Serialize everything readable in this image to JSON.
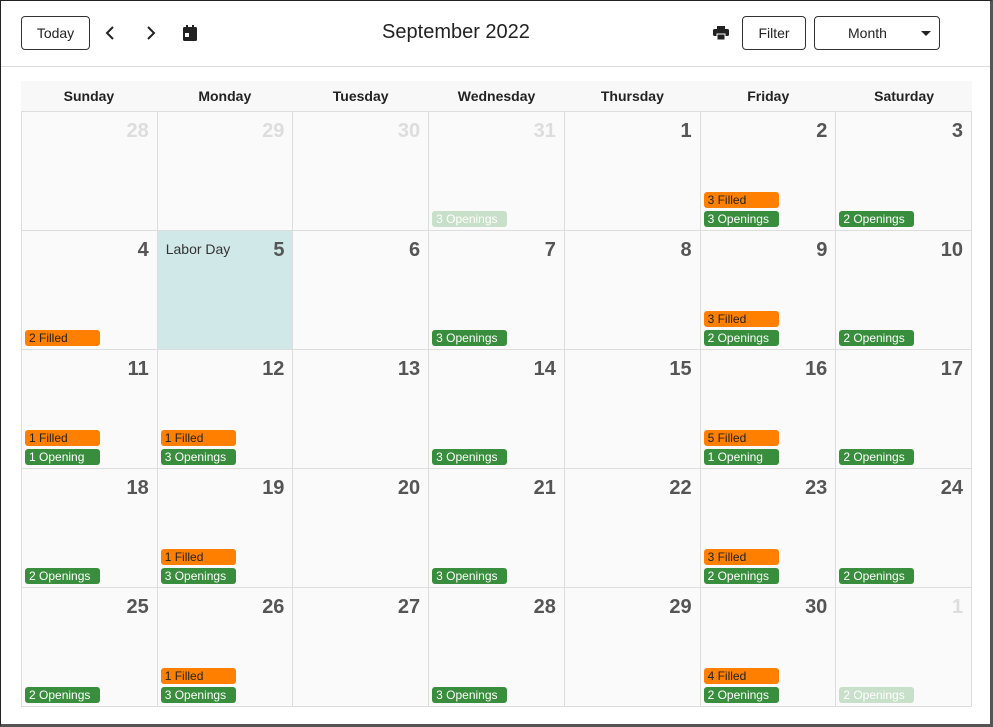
{
  "toolbar": {
    "today_label": "Today",
    "title": "September 2022",
    "filter_label": "Filter",
    "view_label": "Month"
  },
  "colors": {
    "filled": "#ff7f00",
    "openings": "#388e3c",
    "holiday": "#d1e8e9"
  },
  "weekdays": [
    "Sunday",
    "Monday",
    "Tuesday",
    "Wednesday",
    "Thursday",
    "Friday",
    "Saturday"
  ],
  "weeks": [
    [
      {
        "day": "28",
        "muted": true,
        "events": []
      },
      {
        "day": "29",
        "muted": true,
        "events": []
      },
      {
        "day": "30",
        "muted": true,
        "events": []
      },
      {
        "day": "31",
        "muted": true,
        "events": [
          {
            "type": "open",
            "label": "3 Openings"
          }
        ]
      },
      {
        "day": "1",
        "events": []
      },
      {
        "day": "2",
        "events": [
          {
            "type": "filled",
            "label": "3 Filled"
          },
          {
            "type": "open",
            "label": "3 Openings"
          }
        ]
      },
      {
        "day": "3",
        "events": [
          {
            "type": "open",
            "label": "2 Openings"
          }
        ]
      }
    ],
    [
      {
        "day": "4",
        "events": [
          {
            "type": "filled",
            "label": "2 Filled"
          }
        ]
      },
      {
        "day": "5",
        "holiday": "Labor Day",
        "events": []
      },
      {
        "day": "6",
        "events": []
      },
      {
        "day": "7",
        "events": [
          {
            "type": "open",
            "label": "3 Openings"
          }
        ]
      },
      {
        "day": "8",
        "events": []
      },
      {
        "day": "9",
        "events": [
          {
            "type": "filled",
            "label": "3 Filled"
          },
          {
            "type": "open",
            "label": "2 Openings"
          }
        ]
      },
      {
        "day": "10",
        "events": [
          {
            "type": "open",
            "label": "2 Openings"
          }
        ]
      }
    ],
    [
      {
        "day": "11",
        "events": [
          {
            "type": "filled",
            "label": "1 Filled"
          },
          {
            "type": "open",
            "label": "1 Opening"
          }
        ]
      },
      {
        "day": "12",
        "events": [
          {
            "type": "filled",
            "label": "1 Filled"
          },
          {
            "type": "open",
            "label": "3 Openings"
          }
        ]
      },
      {
        "day": "13",
        "events": []
      },
      {
        "day": "14",
        "events": [
          {
            "type": "open",
            "label": "3 Openings"
          }
        ]
      },
      {
        "day": "15",
        "events": []
      },
      {
        "day": "16",
        "events": [
          {
            "type": "filled",
            "label": "5 Filled"
          },
          {
            "type": "open",
            "label": "1 Opening"
          }
        ]
      },
      {
        "day": "17",
        "events": [
          {
            "type": "open",
            "label": "2 Openings"
          }
        ]
      }
    ],
    [
      {
        "day": "18",
        "events": [
          {
            "type": "open",
            "label": "2 Openings"
          }
        ]
      },
      {
        "day": "19",
        "events": [
          {
            "type": "filled",
            "label": "1 Filled"
          },
          {
            "type": "open",
            "label": "3 Openings"
          }
        ]
      },
      {
        "day": "20",
        "events": []
      },
      {
        "day": "21",
        "events": [
          {
            "type": "open",
            "label": "3 Openings"
          }
        ]
      },
      {
        "day": "22",
        "events": []
      },
      {
        "day": "23",
        "events": [
          {
            "type": "filled",
            "label": "3 Filled"
          },
          {
            "type": "open",
            "label": "2 Openings"
          }
        ]
      },
      {
        "day": "24",
        "events": [
          {
            "type": "open",
            "label": "2 Openings"
          }
        ]
      }
    ],
    [
      {
        "day": "25",
        "events": [
          {
            "type": "open",
            "label": "2 Openings"
          }
        ]
      },
      {
        "day": "26",
        "events": [
          {
            "type": "filled",
            "label": "1 Filled"
          },
          {
            "type": "open",
            "label": "3 Openings"
          }
        ]
      },
      {
        "day": "27",
        "events": []
      },
      {
        "day": "28",
        "events": [
          {
            "type": "open",
            "label": "3 Openings"
          }
        ]
      },
      {
        "day": "29",
        "events": []
      },
      {
        "day": "30",
        "events": [
          {
            "type": "filled",
            "label": "4 Filled"
          },
          {
            "type": "open",
            "label": "2 Openings"
          }
        ]
      },
      {
        "day": "1",
        "muted": true,
        "events": [
          {
            "type": "open",
            "label": "2 Openings"
          }
        ]
      }
    ]
  ]
}
